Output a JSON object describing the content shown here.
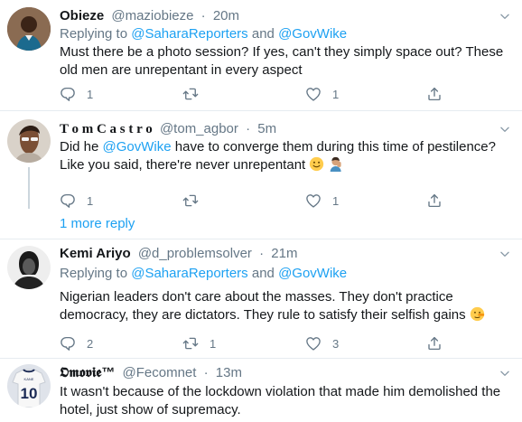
{
  "tweets": [
    {
      "name": "Obieze",
      "handle": "@maziobieze",
      "time": "20m",
      "replying_prefix": "Replying to",
      "replying_to_1": "@SaharaReporters",
      "replying_and": "and",
      "replying_to_2": "@GovWike",
      "text": "Must there be a photo session? If yes, can't they simply space out? These old men are unrepentant in every aspect",
      "reply_count": "1",
      "retweet_count": "",
      "like_count": "1"
    },
    {
      "name": "T o m C a s t r o",
      "handle": "@tom_agbor",
      "time": "5m",
      "text_before": "Did he ",
      "text_mention": "@GovWike",
      "text_after": " have to converge them during this time of pestilence? Like you said, there're never unrepentant",
      "reply_count": "1",
      "retweet_count": "",
      "like_count": "1"
    },
    {
      "name": "Kemi Ariyo",
      "handle": "@d_problemsolver",
      "time": "21m",
      "replying_prefix": "Replying to",
      "replying_to_1": "@SaharaReporters",
      "replying_and": "and",
      "replying_to_2": "@GovWike",
      "text": "Nigerian  leaders don't care about the masses. They don't practice democracy, they are dictators. They rule to satisfy their selfish gains",
      "reply_count": "2",
      "retweet_count": "1",
      "like_count": "3"
    },
    {
      "name": "𝕺𝖒𝖔𝖛𝖎𝖊™",
      "handle": "@Fecomnet",
      "time": "13m",
      "jersey_number": "10",
      "text": "It wasn't because of the lockdown violation that made him demolished the hotel, just show of supremacy."
    }
  ],
  "thread": {
    "more_reply": "1 more reply"
  },
  "meta": {
    "separator": "·"
  },
  "icons": {
    "reply": "reply-icon",
    "retweet": "retweet-icon",
    "like": "like-icon",
    "share": "share-icon",
    "caret": "chevron-down-icon"
  },
  "colors": {
    "accent": "#1da1f2",
    "muted": "#657786",
    "divider": "#e6ecf0"
  }
}
